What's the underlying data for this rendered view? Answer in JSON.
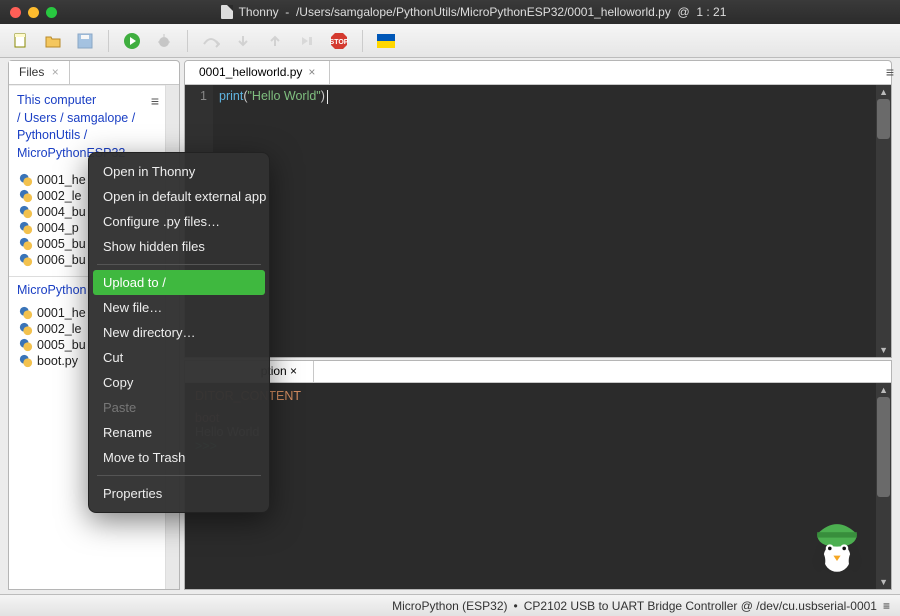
{
  "titlebar": {
    "app": "Thonny",
    "path": "/Users/samgalope/PythonUtils/MicroPythonESP32/0001_helloworld.py",
    "cursor": "1 : 21"
  },
  "toolbar": {
    "new": "new-file-icon",
    "open": "open-folder-icon",
    "save": "save-icon",
    "run": "run-icon",
    "debug": "debug-icon",
    "step_over": "step-over-icon",
    "step_into": "step-into-icon",
    "step_out": "step-out-icon",
    "resume": "resume-icon",
    "stop": "stop-icon",
    "flag": "ukraine-flag-icon"
  },
  "files_tab_label": "Files",
  "breadcrumb": {
    "root": "This computer",
    "parts": [
      "/",
      "Users",
      "/",
      "samgalope",
      "/",
      "PythonUtils",
      "/",
      "MicroPythonESP32"
    ]
  },
  "local_files": [
    "0001_helloworld.py",
    "0002_led.py",
    "0004_button.py",
    "0004_pwm.py",
    "0005_buzzer.py",
    "0006_buzzer2.py"
  ],
  "local_files_visible": [
    "0001_he",
    "0002_le",
    "0004_bu",
    "0004_p",
    "0005_bu",
    "0006_bu"
  ],
  "device_header": "MicroPython",
  "device_files_visible": [
    "0001_he",
    "0002_le",
    "0005_bu",
    "boot.py"
  ],
  "editor": {
    "tab_label": "0001_helloworld.py",
    "line_no": "1",
    "code_fn": "print",
    "code_str": "\"Hello World\""
  },
  "shell": {
    "tab_visible_suffix": "ption",
    "run_line": "DITOR_CONTENT",
    "boot_line": "boot",
    "output": "Hello World",
    "prompt": ">>>"
  },
  "context_menu": {
    "items": [
      {
        "label": "Open in Thonny",
        "enabled": true
      },
      {
        "label": "Open in default external app",
        "enabled": true
      },
      {
        "label": "Configure .py files…",
        "enabled": true
      },
      {
        "label": "Show hidden files",
        "enabled": true
      },
      {
        "label": "Upload to /",
        "enabled": true,
        "highlight": true,
        "sep_before": true
      },
      {
        "label": "New file…",
        "enabled": true
      },
      {
        "label": "New directory…",
        "enabled": true
      },
      {
        "label": "Cut",
        "enabled": true
      },
      {
        "label": "Copy",
        "enabled": true
      },
      {
        "label": "Paste",
        "enabled": false
      },
      {
        "label": "Rename",
        "enabled": true
      },
      {
        "label": "Move to Trash",
        "enabled": true
      },
      {
        "label": "Properties",
        "enabled": true,
        "sep_before": true
      }
    ]
  },
  "status": {
    "interpreter": "MicroPython (ESP32)",
    "sep": "•",
    "port": "CP2102 USB to UART Bridge Controller @ /dev/cu.usbserial-0001"
  }
}
